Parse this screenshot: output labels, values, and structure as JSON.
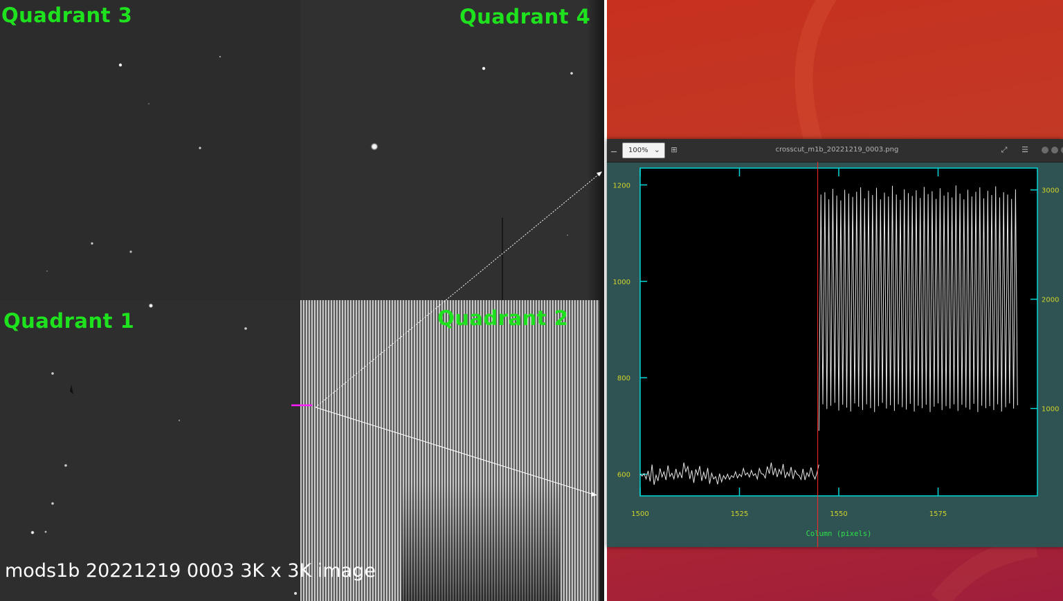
{
  "ccd_image": {
    "quadrant_labels": [
      "Quadrant 3",
      "Quadrant 4",
      "Quadrant 1",
      "Quadrant 2"
    ],
    "caption": "mods1b 20221219 0003 3K x 3K image"
  },
  "viewer": {
    "zoom_value": "100%",
    "title": "crosscut_m1b_20221219_0003.png",
    "colors": {
      "frame": "#00d8d8",
      "axis_text": "#d4d42a",
      "xlabel_color": "#2ee04a",
      "marker": "#ff2a2a",
      "background": "#2e5352",
      "plot_bg": "#000000",
      "trace": "#e8e8e8"
    },
    "icons": [
      "zoom-out-icon",
      "chevron-down-icon",
      "zoom-in-icon",
      "fullscreen-icon",
      "menu-icon",
      "window-dot-icon"
    ]
  },
  "chart_data": {
    "type": "line",
    "title": "",
    "xlabel": "Column (pixels)",
    "ylabel": "",
    "xlim": [
      1500,
      1600
    ],
    "ylim": [
      555,
      1235
    ],
    "xticks": [
      1500,
      1525,
      1550,
      1575
    ],
    "yticks": [
      600,
      800,
      1000,
      1200
    ],
    "y2ticks": [
      1000,
      2000,
      3000
    ],
    "marker_x": 1544.7,
    "series": [
      {
        "x": [
          1500.0,
          1500.5,
          1501.0,
          1501.5,
          1502.0,
          1502.5,
          1503.0,
          1503.5,
          1504.0,
          1504.5,
          1505.0,
          1505.5,
          1506.0,
          1506.5,
          1507.0,
          1507.5,
          1508.0,
          1508.5,
          1509.0,
          1509.5,
          1510.0,
          1510.5,
          1511.0,
          1511.5,
          1512.0,
          1512.5,
          1513.0,
          1513.5,
          1514.0,
          1514.5,
          1515.0,
          1515.5,
          1516.0,
          1516.5,
          1517.0,
          1517.5,
          1518.0,
          1518.5,
          1519.0,
          1519.5,
          1520.0,
          1520.5,
          1521.0,
          1521.5,
          1522.0,
          1522.5,
          1523.0,
          1523.5,
          1524.0,
          1524.5,
          1525.0,
          1525.5,
          1526.0,
          1526.5,
          1527.0,
          1527.5,
          1528.0,
          1528.5,
          1529.0,
          1529.5,
          1530.0,
          1530.5,
          1531.0,
          1531.5,
          1532.0,
          1532.5,
          1533.0,
          1533.5,
          1534.0,
          1534.5,
          1535.0,
          1535.5,
          1536.0,
          1536.5,
          1537.0,
          1537.5,
          1538.0,
          1538.5,
          1539.0,
          1539.5,
          1540.0,
          1540.5,
          1541.0,
          1541.5,
          1542.0,
          1542.5,
          1543.0,
          1543.5,
          1544.0,
          1544.5,
          1545.0
        ],
        "values": [
          600,
          596,
          601,
          590,
          607,
          585,
          620,
          578,
          598,
          586,
          612,
          594,
          605,
          588,
          618,
          595,
          602,
          590,
          611,
          593,
          604,
          592,
          624,
          605,
          616,
          590,
          608,
          582,
          610,
          598,
          617,
          586,
          604,
          590,
          613,
          580,
          602,
          590,
          595,
          579,
          601,
          584,
          597,
          590,
          600,
          589,
          597,
          593,
          605,
          592,
          600,
          595,
          612,
          598,
          603,
          594,
          608,
          597,
          601,
          590,
          612,
          601,
          600,
          592,
          616,
          601,
          624,
          598,
          613,
          594,
          610,
          600,
          621,
          592,
          604,
          596,
          615,
          590,
          608,
          600,
          597,
          589,
          611,
          588,
          603,
          595,
          614,
          599,
          590,
          602,
          620
        ]
      },
      {
        "x": [
          1545.0,
          1545.5,
          1546.0,
          1546.5,
          1547.0,
          1547.5,
          1548.0,
          1548.5,
          1549.0,
          1549.5,
          1550.0,
          1550.5,
          1551.0,
          1551.5,
          1552.0,
          1552.5,
          1553.0,
          1553.5,
          1554.0,
          1554.5,
          1555.0,
          1555.5,
          1556.0,
          1556.5,
          1557.0,
          1557.5,
          1558.0,
          1558.5,
          1559.0,
          1559.5,
          1560.0,
          1560.5,
          1561.0,
          1561.5,
          1562.0,
          1562.5,
          1563.0,
          1563.5,
          1564.0,
          1564.5,
          1565.0,
          1565.5,
          1566.0,
          1566.5,
          1567.0,
          1567.5,
          1568.0,
          1568.5,
          1569.0,
          1569.5,
          1570.0,
          1570.5,
          1571.0,
          1571.5,
          1572.0,
          1572.5,
          1573.0,
          1573.5,
          1574.0,
          1574.5,
          1575.0,
          1575.5,
          1576.0,
          1576.5,
          1577.0,
          1577.5,
          1578.0,
          1578.5,
          1579.0,
          1579.5,
          1580.0,
          1580.5,
          1581.0,
          1581.5,
          1582.0,
          1582.5,
          1583.0,
          1583.5,
          1584.0,
          1584.5,
          1585.0,
          1585.5,
          1586.0,
          1586.5,
          1587.0,
          1587.5,
          1588.0,
          1588.5,
          1589.0,
          1589.5,
          1590.0,
          1590.5,
          1591.0,
          1591.5,
          1592.0,
          1592.5,
          1593.0,
          1593.5,
          1594.0,
          1594.5,
          1595.0
        ],
        "values": [
          690,
          1180,
          745,
          1185,
          735,
          1170,
          742,
          1192,
          748,
          1178,
          732,
          1168,
          744,
          1190,
          738,
          1182,
          730,
          1175,
          747,
          1186,
          740,
          1195,
          733,
          1172,
          745,
          1188,
          737,
          1179,
          729,
          1194,
          741,
          1170,
          748,
          1184,
          736,
          1176,
          743,
          1198,
          731,
          1180,
          745,
          1169,
          739,
          1191,
          734,
          1183,
          746,
          1177,
          730,
          1189,
          742,
          1173,
          737,
          1196,
          744,
          1181,
          729,
          1187,
          740,
          1171,
          747,
          1193,
          733,
          1178,
          741,
          1185,
          736,
          1174,
          745,
          1199,
          731,
          1182,
          744,
          1170,
          738,
          1190,
          734,
          1176,
          746,
          1186,
          729,
          1195,
          742,
          1172,
          737,
          1188,
          741,
          1179,
          733,
          1197,
          745,
          1174,
          730,
          1185,
          739,
          1180,
          747,
          1171,
          736,
          1191,
          743
        ]
      }
    ]
  }
}
